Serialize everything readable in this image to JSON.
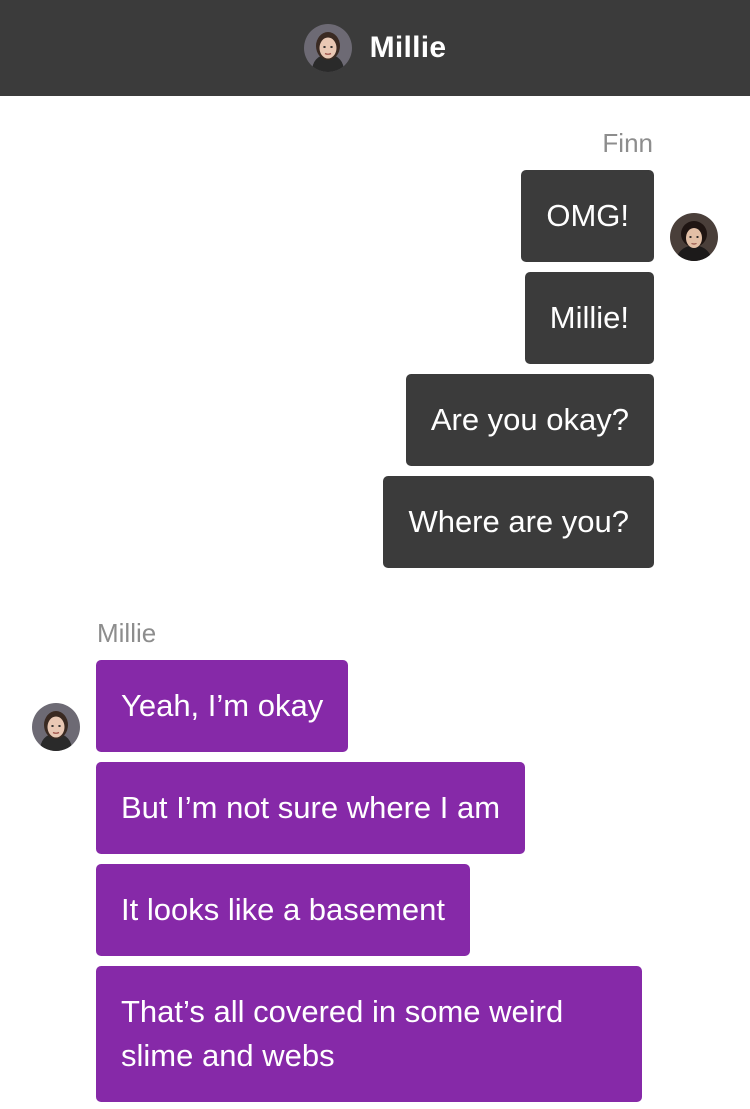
{
  "header": {
    "title": "Millie",
    "avatar_icon": "millie-avatar-icon"
  },
  "colors": {
    "header_bg": "#3b3b3b",
    "finn_bubble": "#3b3b3b",
    "millie_bubble": "#8629a8",
    "sender_name": "#8d8d8d"
  },
  "conversation": {
    "finn": {
      "name": "Finn",
      "avatar_icon": "finn-avatar-icon",
      "messages": [
        "OMG!",
        "Millie!",
        "Are you okay?",
        "Where are you?"
      ]
    },
    "millie": {
      "name": "Millie",
      "avatar_icon": "millie-avatar-icon",
      "messages": [
        "Yeah, I’m okay",
        "But I’m not sure where I am",
        "It looks like a basement",
        "That’s all covered in some weird slime and webs"
      ]
    }
  }
}
